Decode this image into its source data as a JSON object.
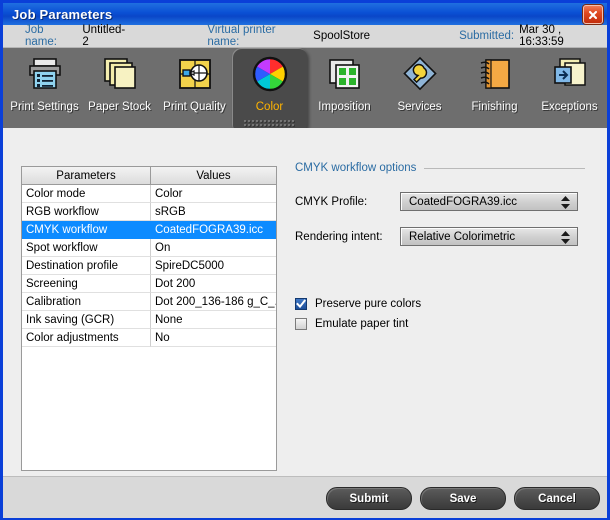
{
  "window": {
    "title": "Job Parameters",
    "close_icon": "close-icon"
  },
  "info": {
    "job_name_label": "Job name:",
    "job_name_value": "Untitled-2",
    "printer_label": "Virtual printer name:",
    "printer_value": "SpoolStore",
    "submitted_label": "Submitted:",
    "submitted_value": "Mar 30 , 16:33:59"
  },
  "tabs": [
    {
      "label": "Print Settings",
      "icon": "printer-icon",
      "selected": false
    },
    {
      "label": "Paper Stock",
      "icon": "paper-stack-icon",
      "selected": false
    },
    {
      "label": "Print Quality",
      "icon": "print-quality-icon",
      "selected": false
    },
    {
      "label": "Color",
      "icon": "color-wheel-icon",
      "selected": true
    },
    {
      "label": "Imposition",
      "icon": "imposition-grid-icon",
      "selected": false
    },
    {
      "label": "Services",
      "icon": "wrench-diamond-icon",
      "selected": false
    },
    {
      "label": "Finishing",
      "icon": "spiral-book-icon",
      "selected": false
    },
    {
      "label": "Exceptions",
      "icon": "exception-pages-icon",
      "selected": false
    }
  ],
  "table": {
    "columns": [
      "Parameters",
      "Values"
    ],
    "rows": [
      {
        "parameter": "Color mode",
        "value": "Color",
        "selected": false
      },
      {
        "parameter": "RGB workflow",
        "value": "sRGB",
        "selected": false
      },
      {
        "parameter": "CMYK workflow",
        "value": "CoatedFOGRA39.icc",
        "selected": true
      },
      {
        "parameter": "Spot workflow",
        "value": "On",
        "selected": false
      },
      {
        "parameter": "Destination profile",
        "value": "SpireDC5000",
        "selected": false
      },
      {
        "parameter": "Screening",
        "value": "Dot 200",
        "selected": false
      },
      {
        "parameter": "Calibration",
        "value": "Dot 200_136-186 g_C_...",
        "selected": false
      },
      {
        "parameter": "Ink saving (GCR)",
        "value": "None",
        "selected": false
      },
      {
        "parameter": "Color adjustments",
        "value": "No",
        "selected": false
      }
    ]
  },
  "options": {
    "group_title": "CMYK workflow options",
    "fields": [
      {
        "label": "CMYK Profile:",
        "value": "CoatedFOGRA39.icc"
      },
      {
        "label": "Rendering intent:",
        "value": "Relative Colorimetric"
      }
    ],
    "checkboxes": [
      {
        "label": "Preserve pure colors",
        "checked": true
      },
      {
        "label": "Emulate paper tint",
        "checked": false
      }
    ]
  },
  "footer": {
    "submit_label": "Submit",
    "save_label": "Save",
    "cancel_label": "Cancel"
  },
  "colors": {
    "titlebar_blue": "#0a4fd4",
    "window_border": "#0a3fd8",
    "tabstrip_gray": "#6e6e6e",
    "selected_tab_gray": "#4a4a4a",
    "selected_tab_label": "#ffb400",
    "row_highlight": "#0d8bff",
    "group_label_blue": "#2b6ca3",
    "info_label_blue": "#2b6ca3"
  }
}
